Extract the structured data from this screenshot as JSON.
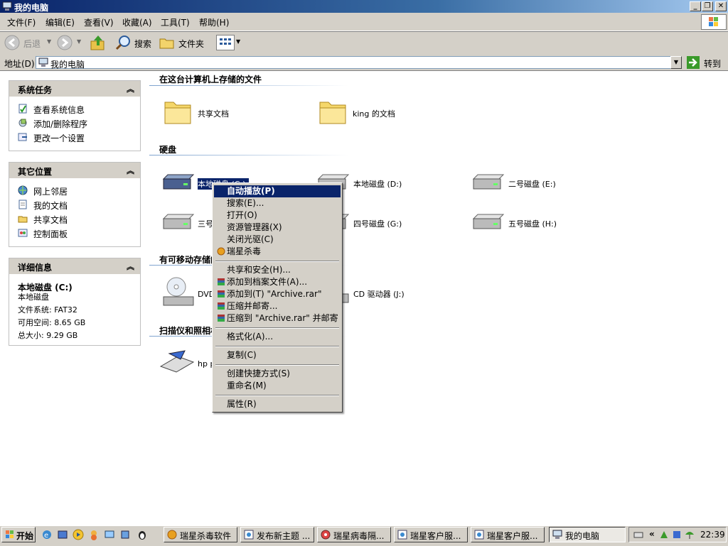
{
  "window": {
    "title": "我的电脑"
  },
  "menu": [
    "文件(F)",
    "编辑(E)",
    "查看(V)",
    "收藏(A)",
    "工具(T)",
    "帮助(H)"
  ],
  "toolbar": {
    "back": "后退",
    "search": "搜索",
    "folders": "文件夹"
  },
  "address": {
    "label": "地址(D)",
    "value": "我的电脑",
    "go": "转到"
  },
  "panels": {
    "system_tasks": {
      "title": "系统任务",
      "items": [
        "查看系统信息",
        "添加/删除程序",
        "更改一个设置"
      ]
    },
    "other_places": {
      "title": "其它位置",
      "items": [
        "网上邻居",
        "我的文档",
        "共享文档",
        "控制面板"
      ]
    },
    "details": {
      "title": "详细信息",
      "name": "本地磁盘 (C:)",
      "type": "本地磁盘",
      "fs": "文件系统: FAT32",
      "free": "可用空间: 8.65 GB",
      "total": "总大小: 9.29 GB"
    }
  },
  "sections": {
    "stored": {
      "title": "在这台计算机上存储的文件",
      "items": [
        "共享文档",
        "king 的文档"
      ]
    },
    "hdd": {
      "title": "硬盘",
      "items": [
        "本地磁盘 (C:)",
        "本地磁盘 (D:)",
        "二号磁盘 (E:)",
        "三号磁盘 (F:)",
        "四号磁盘 (G:)",
        "五号磁盘 (H:)"
      ]
    },
    "removable": {
      "title": "有可移动存储的设备",
      "items": [
        "DVD 驱动器 (I:)",
        "CD 驱动器 (J:)"
      ]
    },
    "scanners": {
      "title": "扫描仪和照相机",
      "items": [
        "hp psc 1200"
      ]
    }
  },
  "context_menu": {
    "items": [
      "自动播放(P)",
      "搜索(E)...",
      "打开(O)",
      "资源管理器(X)",
      "关闭光驱(C)",
      "瑞星杀毒",
      "共享和安全(H)...",
      "添加到档案文件(A)...",
      "添加到(T) \"Archive.rar\"",
      "压缩并邮寄...",
      "压缩到 \"Archive.rar\" 并邮寄",
      "格式化(A)...",
      "复制(C)",
      "创建快捷方式(S)",
      "重命名(M)",
      "属性(R)"
    ]
  },
  "taskbar": {
    "start": "开始",
    "tasks": [
      "瑞星杀毒软件",
      "发布新主题 ...",
      "瑞星病毒隔...",
      "瑞星客户服...",
      "瑞星客户服...",
      "我的电脑"
    ],
    "clock": "22:39"
  }
}
